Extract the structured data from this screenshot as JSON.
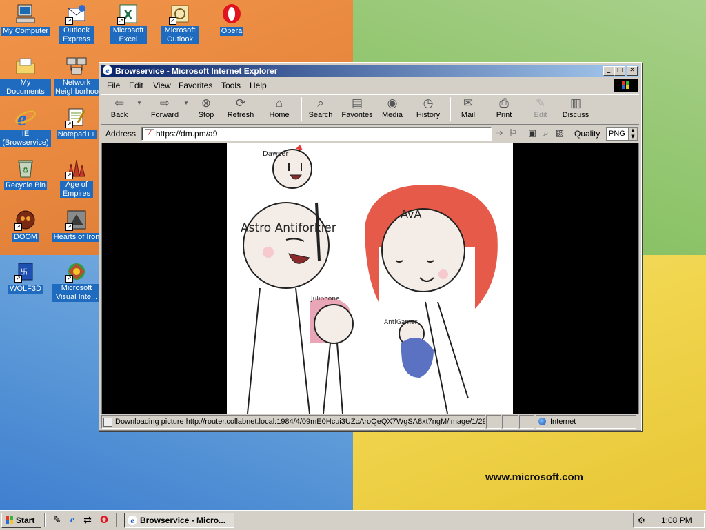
{
  "desktop": {
    "icons": [
      {
        "label": "My Computer"
      },
      {
        "label": "Outlook Express"
      },
      {
        "label": "Microsoft Excel"
      },
      {
        "label": "Microsoft Outlook"
      },
      {
        "label": "Opera"
      },
      {
        "label": "My Documents"
      },
      {
        "label": "Network Neighborhood"
      },
      {
        "label": "IE (Browservice)"
      },
      {
        "label": "Notepad++"
      },
      {
        "label": "Recycle Bin"
      },
      {
        "label": "Age of Empires"
      },
      {
        "label": "DOOM"
      },
      {
        "label": "Hearts of Iron"
      },
      {
        "label": "WOLF3D"
      },
      {
        "label": "Microsoft Visual Inte..."
      }
    ],
    "brand": "www.microsoft.com"
  },
  "window": {
    "title": "Browservice - Microsoft Internet Explorer",
    "menu": [
      "File",
      "Edit",
      "View",
      "Favorites",
      "Tools",
      "Help"
    ],
    "toolbar": [
      "Back",
      "Forward",
      "Stop",
      "Refresh",
      "Home",
      "Search",
      "Favorites",
      "Media",
      "History",
      "Mail",
      "Print",
      "Edit",
      "Discuss"
    ],
    "address_label": "Address",
    "address_value": "https://dm.pm/a9",
    "quality_label": "Quality",
    "quality_value": "PNG",
    "picture_labels": {
      "a": "Dawser",
      "b": "Astro Antiforkier",
      "c": "AvA",
      "d": "Juliphone",
      "e": "AntiGamer"
    },
    "status_text": "Downloading picture http://router.collabnet.local:1984/4/09mE0Hcui3UZcAroQeQX7WgSA8xt7ngM/image/1/29",
    "zone": "Internet"
  },
  "taskbar": {
    "start": "Start",
    "task": "Browservice - Micro...",
    "clock": "1:08 PM"
  },
  "colors": {
    "title_active": "#0a246a",
    "face": "#d4d0c8",
    "desktop_label_bg": "#1e6bbf"
  }
}
